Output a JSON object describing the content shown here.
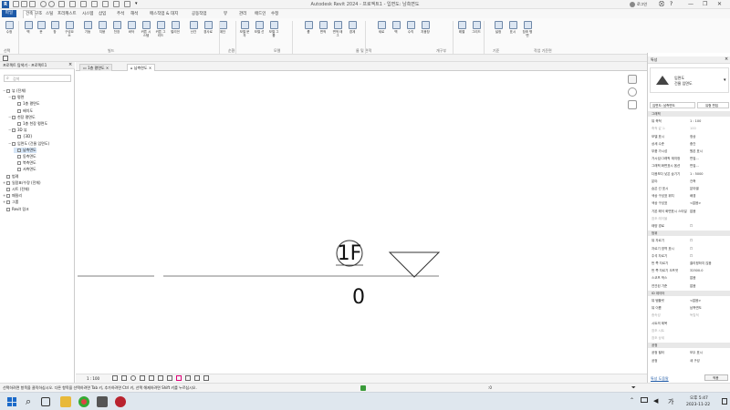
{
  "app": {
    "title": "Autodesk Revit 2024 - 프로젝트1 - 입면도: 남측면도",
    "sign_in": "로그인",
    "window_controls": [
      "—",
      "❐",
      "✕"
    ]
  },
  "ribbon": {
    "file_tab": "파일",
    "tabs": [
      "건축",
      "구조",
      "스틸",
      "프리캐스트",
      "시스템",
      "삽입",
      "주석",
      "해석",
      "매스작업 & 대지",
      "공동작업",
      "뷰",
      "관리",
      "애드인",
      "수정"
    ],
    "active_tab_index": 0,
    "buttons": [
      {
        "label": "수정"
      },
      {
        "label": "벽"
      },
      {
        "label": "문"
      },
      {
        "label": "창"
      },
      {
        "label": "구성요소"
      },
      {
        "label": "기둥"
      },
      {
        "label": "지붕"
      },
      {
        "label": "천장"
      },
      {
        "label": "바닥"
      },
      {
        "label": "커튼 시스템"
      },
      {
        "label": "커튼 그리드"
      },
      {
        "label": "멀리언"
      },
      {
        "label": "난간"
      },
      {
        "label": "경사로"
      },
      {
        "label": "계단"
      },
      {
        "label": "모델 문자"
      },
      {
        "label": "모델 선"
      },
      {
        "label": "모델 그룹"
      },
      {
        "label": "룸"
      },
      {
        "label": "면적"
      },
      {
        "label": "면적 태그"
      },
      {
        "label": "경계"
      },
      {
        "label": "세로"
      },
      {
        "label": "벽"
      },
      {
        "label": "수직"
      },
      {
        "label": "지붕창"
      },
      {
        "label": "레벨"
      },
      {
        "label": "그리드"
      },
      {
        "label": "설정"
      },
      {
        "label": "표시"
      },
      {
        "label": "참조 평면"
      }
    ],
    "panels": [
      "선택",
      "빌드",
      "순환",
      "모델",
      "룸 및 면적",
      "개구부",
      "기준",
      "작업 기준면"
    ]
  },
  "browser": {
    "title": "프로젝트 탐색기 - 프로젝트1",
    "search_placeholder": "검색",
    "tree": [
      {
        "label": "뷰 (전체)",
        "level": 0,
        "toggle": "−"
      },
      {
        "label": "평면",
        "level": 1,
        "toggle": "−"
      },
      {
        "label": "1층 평면도",
        "level": 2,
        "toggle": ""
      },
      {
        "label": "배치도",
        "level": 2,
        "toggle": ""
      },
      {
        "label": "천장 평면도",
        "level": 1,
        "toggle": "−"
      },
      {
        "label": "1층 천장 평면도",
        "level": 2,
        "toggle": ""
      },
      {
        "label": "3D 뷰",
        "level": 1,
        "toggle": "−"
      },
      {
        "label": "{3D}",
        "level": 2,
        "toggle": ""
      },
      {
        "label": "입면도 (건물 입면도)",
        "level": 1,
        "toggle": "−"
      },
      {
        "label": "남측면도",
        "level": 2,
        "toggle": ""
      },
      {
        "label": "동측면도",
        "level": 2,
        "toggle": ""
      },
      {
        "label": "북측면도",
        "level": 2,
        "toggle": ""
      },
      {
        "label": "서측면도",
        "level": 2,
        "toggle": ""
      },
      {
        "label": "범례",
        "level": 0,
        "toggle": ""
      },
      {
        "label": "일람표/수량 (전체)",
        "level": 0,
        "toggle": "+"
      },
      {
        "label": "시트 (전체)",
        "level": 0,
        "toggle": ""
      },
      {
        "label": "패밀리",
        "level": 0,
        "toggle": "+"
      },
      {
        "label": "그룹",
        "level": 0,
        "toggle": "+"
      },
      {
        "label": "Revit 링크",
        "level": 0,
        "toggle": ""
      }
    ]
  },
  "view_tabs": [
    {
      "label": "1층 평면도",
      "active": false
    },
    {
      "label": "남측면도",
      "active": true
    }
  ],
  "canvas": {
    "level_name": "1F",
    "level_elevation": "0"
  },
  "view_control": {
    "scale": "1 : 100"
  },
  "properties": {
    "title": "특성",
    "type_family": "입면도",
    "type_name": "건물 입면도",
    "selector": "입면도: 남측면도",
    "edit_type": "유형 편집",
    "rows": [
      {
        "k": "그래픽",
        "v": "",
        "section": true
      },
      {
        "k": "뷰 축척",
        "v": "1 : 100"
      },
      {
        "k": "축척 값  1:",
        "v": "100",
        "grey": true
      },
      {
        "k": "모델 표시",
        "v": "정상"
      },
      {
        "k": "상세 수준",
        "v": "중간"
      },
      {
        "k": "부품 가시성",
        "v": "원본 표시"
      },
      {
        "k": "가시성/그래픽 재지정",
        "v": "편집..."
      },
      {
        "k": "그래픽 화면표시 옵션",
        "v": "편집..."
      },
      {
        "k": "다음보다 낮은 숨기기",
        "v": "1 : 5000"
      },
      {
        "k": "분야",
        "v": "건축"
      },
      {
        "k": "숨은 선 표시",
        "v": "분야별"
      },
      {
        "k": "색상 구성표 위치",
        "v": "배경"
      },
      {
        "k": "색상 구성표",
        "v": "<없음>"
      },
      {
        "k": "기본 해석 화면표시 스타일",
        "v": "없음"
      },
      {
        "k": "참조 레이블",
        "v": "",
        "grey": true
      },
      {
        "k": "태양 경로",
        "v": "☐"
      },
      {
        "k": "범위",
        "v": "",
        "section": true
      },
      {
        "k": "뷰 자르기",
        "v": "☐"
      },
      {
        "k": "자르기 영역 표시",
        "v": "☐"
      },
      {
        "k": "주석 자르기",
        "v": "☐"
      },
      {
        "k": "먼 쪽 자르기",
        "v": "클리핑하지 않음"
      },
      {
        "k": "먼 쪽 자르기 오프셋",
        "v": "32500.0"
      },
      {
        "k": "스코프 박스",
        "v": "없음"
      },
      {
        "k": "연관된 기준",
        "v": "없음"
      },
      {
        "k": "ID 데이터",
        "v": "",
        "section": true
      },
      {
        "k": "뷰 템플릿",
        "v": "<없음>"
      },
      {
        "k": "뷰 이름",
        "v": "남측면도"
      },
      {
        "k": "종속성",
        "v": "독립적",
        "grey": true
      },
      {
        "k": "시트의 제목",
        "v": ""
      },
      {
        "k": "참조 시트",
        "v": "",
        "grey": true
      },
      {
        "k": "참조 상세",
        "v": "",
        "grey": true
      },
      {
        "k": "공정",
        "v": "",
        "section": true
      },
      {
        "k": "공정 필터",
        "v": "모두 표시"
      },
      {
        "k": "공정",
        "v": "새 구성"
      }
    ],
    "help_link": "특성 도움말",
    "apply_button": "적용"
  },
  "status": {
    "text": "선택하려면 항목을 클릭하십시오. 다른 항목을 선택하려면 Tab 키, 추가하려면 Ctrl 키, 선택 해제하려면 Shift 키를 누르십시오.",
    "selection_count": ":0"
  },
  "taskbar": {
    "time": "오후 5:47",
    "date": "2023-11-22"
  }
}
